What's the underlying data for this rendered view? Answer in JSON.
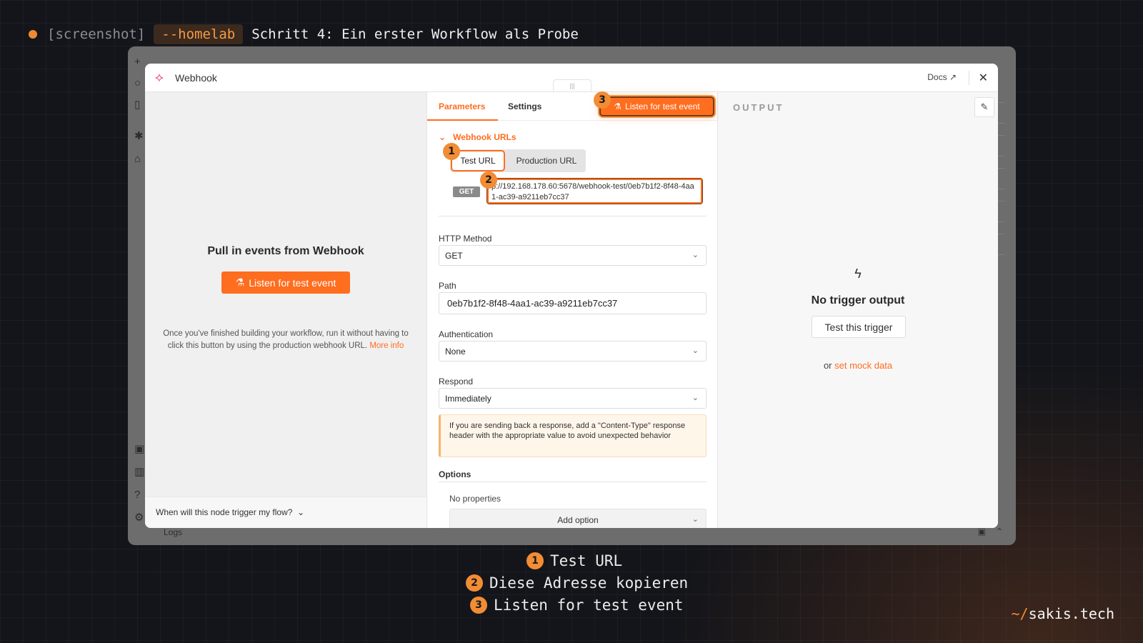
{
  "caption": {
    "tag": "[screenshot]",
    "pill": "--homelab",
    "title": "Schritt 4: Ein erster Workflow als Probe"
  },
  "background_app": {
    "logs_label": "Logs"
  },
  "modal": {
    "title": "Webhook",
    "node_icon": "webhook-icon",
    "docs_label": "Docs",
    "close_label": "✕"
  },
  "left_panel": {
    "heading": "Pull in events from Webhook",
    "listen_button": "Listen for test event",
    "hint_text": "Once you've finished building your workflow, run it without having to click this button by using the production webhook URL.",
    "more_info": "More info",
    "footer_question": "When will this node trigger my flow?"
  },
  "params": {
    "tabs": [
      "Parameters",
      "Settings"
    ],
    "active_tab": "Parameters",
    "listen_button": "Listen for test event",
    "section_title": "Webhook URLs",
    "url_tabs": [
      "Test URL",
      "Production URL"
    ],
    "method_badge": "GET",
    "url_value": "p://192.168.178.60:5678/webhook-test/0eb7b1f2-8f48-4aa1-ac39-a9211eb7cc37",
    "fields": {
      "http_method_label": "HTTP Method",
      "http_method_value": "GET",
      "path_label": "Path",
      "path_value": "0eb7b1f2-8f48-4aa1-ac39-a9211eb7cc37",
      "auth_label": "Authentication",
      "auth_value": "None",
      "respond_label": "Respond",
      "respond_value": "Immediately"
    },
    "notice": "If you are sending back a response, add a \"Content-Type\" response header with the appropriate value to avoid unexpected behavior",
    "options_label": "Options",
    "no_properties": "No properties",
    "add_option": "Add option"
  },
  "output": {
    "title": "OUTPUT",
    "empty_title": "No trigger output",
    "test_button": "Test this trigger",
    "or_text": "or",
    "mock_link": "set mock data"
  },
  "annotations": [
    {
      "number": "1",
      "text": "Test URL"
    },
    {
      "number": "2",
      "text": "Diese Adresse kopieren"
    },
    {
      "number": "3",
      "text": "Listen for test event"
    }
  ],
  "brand": {
    "prefix": "~/",
    "name": "sakis.tech"
  },
  "colors": {
    "accent": "#ff6d1f",
    "badge": "#f28c35",
    "background": "#14151a"
  }
}
